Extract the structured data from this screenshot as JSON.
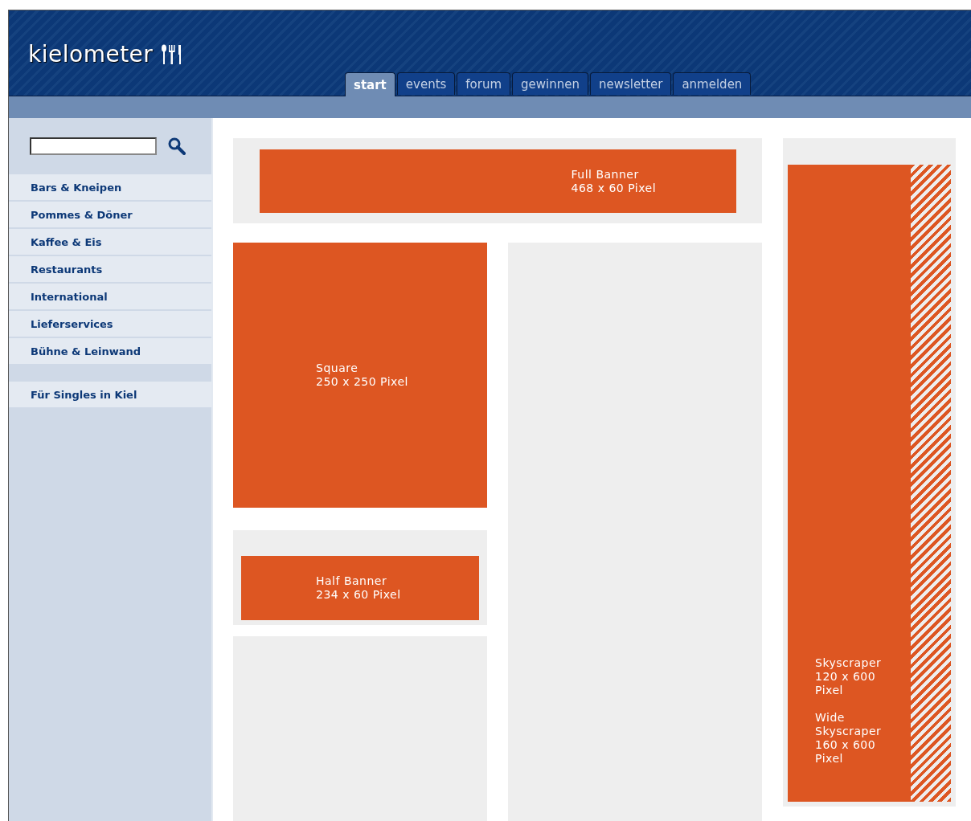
{
  "header": {
    "logo": "kielometer"
  },
  "tabs": [
    {
      "label": "start",
      "selected": true
    },
    {
      "label": "events",
      "selected": false
    },
    {
      "label": "forum",
      "selected": false
    },
    {
      "label": "gewinnen",
      "selected": false
    },
    {
      "label": "newsletter",
      "selected": false
    },
    {
      "label": "anmelden",
      "selected": false
    }
  ],
  "sidebar": {
    "items": [
      "Bars & Kneipen",
      "Pommes & Döner",
      "Kaffee & Eis",
      "Restaurants",
      "International",
      "Lieferservices",
      "Bühne & Leinwand"
    ],
    "extra_items": [
      "Für Singles in Kiel"
    ]
  },
  "ads": {
    "full_banner": "Full Banner\n468 x 60 Pixel",
    "square": "Square\n250 x 250 Pixel",
    "half_banner": "Half Banner\n234 x 60 Pixel",
    "skyscraper": [
      "Skyscraper\n120 x 600\nPixel",
      "Wide\nSkyscraper\n160 x 600\nPixel"
    ]
  }
}
